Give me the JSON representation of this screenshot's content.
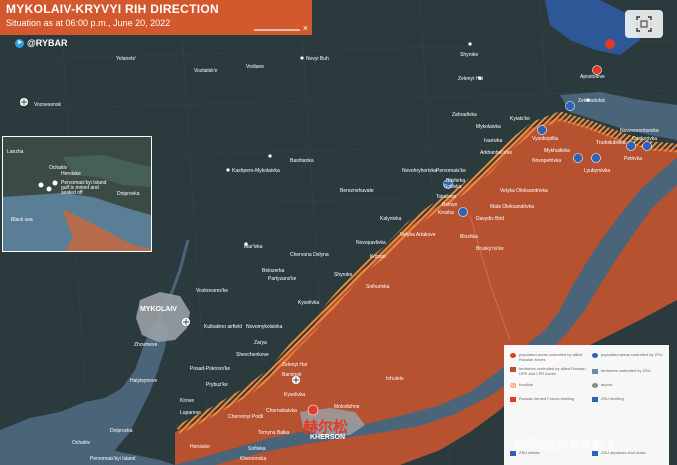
{
  "header": {
    "title": "MYKOLAIV-KRYVYI RIH DIRECTION",
    "subtitle": "Situation as at 06:00 p.m., June 20, 2022",
    "close_glyph": "×"
  },
  "brand": {
    "telegram_icon": "telegram-icon",
    "text": "@RYBAR"
  },
  "colors": {
    "terrain": "#2b3a3c",
    "water": "#4a647a",
    "russian_controlled": "#b75230",
    "front_line": "#ef8a3a",
    "city_area": "#9aa1a5",
    "header": "#d4582d"
  },
  "places": [
    {
      "id": "yelanets",
      "name": "Yelanets'"
    },
    {
      "id": "voznesensk",
      "name": "Voznesensk"
    },
    {
      "id": "vodiane",
      "name": "Vodiane"
    },
    {
      "id": "vozzyiatske",
      "name": "Voziiatsk'e"
    },
    {
      "id": "novyi-buh",
      "name": "Novyi Buh"
    },
    {
      "id": "shyroke",
      "name": "Shyroke"
    },
    {
      "id": "apostolove",
      "name": "Apostolove"
    },
    {
      "id": "zelenyi-hai-n",
      "name": "Zelenyi Hai"
    },
    {
      "id": "zelenodolsk",
      "name": "Zelenodolsk"
    },
    {
      "id": "zahradivka",
      "name": "Zahradivka"
    },
    {
      "id": "kyiatske",
      "name": "Kyiats'ke"
    },
    {
      "id": "mykolaivka",
      "name": "Mykolaivka"
    },
    {
      "id": "vysokopillia",
      "name": "Vysokopillia"
    },
    {
      "id": "ivanivka",
      "name": "Ivanivka"
    },
    {
      "id": "arkhanhelske",
      "name": "Arkhanhel's'ke"
    },
    {
      "id": "mykhailivka",
      "name": "Mykhailivka"
    },
    {
      "id": "novopetrivka",
      "name": "Novopetrivka"
    },
    {
      "id": "trudoliubivka",
      "name": "Trudoliubivka"
    },
    {
      "id": "novovorontsovka",
      "name": "Novovorontsovka"
    },
    {
      "id": "osokorivka",
      "name": "Osokorivka"
    },
    {
      "id": "petrivka",
      "name": "Petrivka"
    },
    {
      "id": "lyubymivka",
      "name": "Lyubymivka"
    },
    {
      "id": "bashtanka",
      "name": "Bashtanka"
    },
    {
      "id": "kashpero",
      "name": "Kashpero-Mykolaivka"
    },
    {
      "id": "novohryhorivka",
      "name": "Novohryhorivka"
    },
    {
      "id": "bereznehuvate",
      "name": "Bereznehuvate"
    },
    {
      "id": "pervomaiske",
      "name": "Pervomais'ke"
    },
    {
      "id": "bilohirka",
      "name": "Bilohirka"
    },
    {
      "id": "sofiivka",
      "name": "Sofiivka"
    },
    {
      "id": "velyka-oleksandrivka",
      "name": "Velyka Oleksandrivka"
    },
    {
      "id": "mala-oleksandrivka",
      "name": "Mala Oleksandrivka"
    },
    {
      "id": "tokarevo",
      "name": "Tokarevo"
    },
    {
      "id": "beloye",
      "name": "Beloye"
    },
    {
      "id": "krosha",
      "name": "Krosha"
    },
    {
      "id": "davydiv-brid",
      "name": "Davydiv Brid"
    },
    {
      "id": "bloshka",
      "name": "Bloshka"
    },
    {
      "id": "kalynivka",
      "name": "Kalynivka"
    },
    {
      "id": "velyka-artakove",
      "name": "Velyka Artakove"
    },
    {
      "id": "bruskynske",
      "name": "Brusky'ns'ke"
    },
    {
      "id": "novopavlivka",
      "name": "Novopavlivka"
    },
    {
      "id": "marivka",
      "name": "Mar'ivka"
    },
    {
      "id": "chervona-dolyna",
      "name": "Chervona Dolyna"
    },
    {
      "id": "kotzari",
      "name": "Kotzari"
    },
    {
      "id": "belozerka",
      "name": "Belozerka"
    },
    {
      "id": "partyzanske",
      "name": "Partyzans'ke"
    },
    {
      "id": "shyroke-s",
      "name": "Shyroke"
    },
    {
      "id": "snihurivka",
      "name": "Snihurivka"
    },
    {
      "id": "kyselivka",
      "name": "Kyselivka"
    },
    {
      "id": "voskresenske",
      "name": "Voskresens'ke"
    },
    {
      "id": "mykolaiv",
      "name": "MYKOLAIV"
    },
    {
      "id": "kulbakino",
      "name": "Kulbakino airfield"
    },
    {
      "id": "novomykolaivka",
      "name": "Novomykolaivka"
    },
    {
      "id": "zarya",
      "name": "Zarya"
    },
    {
      "id": "zhovtneve",
      "name": "Zhovtneve"
    },
    {
      "id": "shevchenkove",
      "name": "Shevchenkove"
    },
    {
      "id": "halytsynove",
      "name": "Halytsynove"
    },
    {
      "id": "posad-pokrovske",
      "name": "Posad-Pokrovs'ke"
    },
    {
      "id": "zelenyi-hai-s",
      "name": "Zelenyi Hai"
    },
    {
      "id": "barvinok",
      "name": "Barvinok"
    },
    {
      "id": "prybuzke",
      "name": "Prybuz'ke"
    },
    {
      "id": "kyselivka2",
      "name": "Kyselivka"
    },
    {
      "id": "kirove",
      "name": "Kirove"
    },
    {
      "id": "lupareve",
      "name": "Lupareve"
    },
    {
      "id": "chervonyi-podil",
      "name": "Chervonyi Podil"
    },
    {
      "id": "chornobaivka",
      "name": "Chornobaivka"
    },
    {
      "id": "tomyna-balka",
      "name": "Tomyna Balka"
    },
    {
      "id": "inhulets",
      "name": "Inhulets"
    },
    {
      "id": "molodizhne",
      "name": "Molodizhne"
    },
    {
      "id": "kherson",
      "name": "KHERSON"
    },
    {
      "id": "ochakiv",
      "name": "Ochakiv"
    },
    {
      "id": "dniprovka",
      "name": "Dniprovka"
    },
    {
      "id": "pervomaiskyi-island",
      "name": "Pervomais'kyi Island"
    },
    {
      "id": "heroiske",
      "name": "Heroiske"
    },
    {
      "id": "solianka",
      "name": "Sofiivka"
    },
    {
      "id": "khersonska",
      "name": "Khersonska"
    }
  ],
  "inset": {
    "labels": [
      "Lanzha",
      "Ochakiv",
      "Dniprovka",
      "Heroiske",
      "Black sea"
    ],
    "note": "Pervomais'kyi Island gulf is mined and sealed off"
  },
  "legend": {
    "items": [
      "populated areas controlled by allied Russian forces",
      "territories controlled by allied Russian, DPR and LPR forces",
      "frontline",
      "Russian Armed Forces shelling",
      "populated areas controlled by ZSU",
      "territories controlled by ZSU",
      "airport",
      "ZSU shelling",
      "ZSU strikes",
      "ZSU airplanes shot down"
    ]
  },
  "watermarks": {
    "cn_overlay": "赫尔松",
    "social": "知闻社区@棉花絮飞"
  },
  "controls": {
    "fullscreen_icon": "fullscreen-icon"
  }
}
